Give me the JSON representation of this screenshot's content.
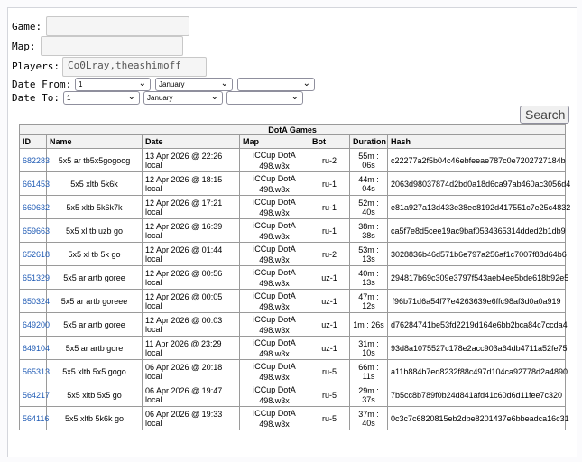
{
  "form": {
    "game_label": "Game:",
    "game_value": "",
    "map_label": "Map:",
    "map_value": "",
    "players_label": "Players:",
    "players_value": "Co0Lray,theashimoff",
    "date_from_label": "Date From:",
    "date_to_label": "Date To:",
    "from_day": "1",
    "from_month": "January",
    "from_year": "",
    "to_day": "1",
    "to_month": "January",
    "to_year": "",
    "search_label": "Search"
  },
  "table": {
    "caption": "DotA Games",
    "headers": [
      "ID",
      "Name",
      "Date",
      "Map",
      "Bot",
      "Duration",
      "Hash"
    ],
    "rows": [
      {
        "id": "682283",
        "name": "5x5 ar tb5x5gogoog",
        "date": "13 Apr 2026 @ 22:26 local",
        "map1": "iCCup DotA",
        "map2": "498.w3x",
        "bot": "ru-2",
        "duration": "55m : 06s",
        "hash": "c22277a2f5b04c46ebfeeae787c0e7202727184b"
      },
      {
        "id": "661453",
        "name": "5x5 xltb 5k6k",
        "date": "12 Apr 2026 @ 18:15 local",
        "map1": "iCCup DotA",
        "map2": "498.w3x",
        "bot": "ru-1",
        "duration": "44m : 04s",
        "hash": "2063d98037874d2bd0a18d6ca97ab460ac3056d4"
      },
      {
        "id": "660632",
        "name": "5x5 xltb 5k6k7k",
        "date": "12 Apr 2026 @ 17:21 local",
        "map1": "iCCup DotA",
        "map2": "498.w3x",
        "bot": "ru-1",
        "duration": "52m : 40s",
        "hash": "e81a927a13d433e38ee8192d417551c7e25c4832"
      },
      {
        "id": "659663",
        "name": "5x5 xl tb uzb go",
        "date": "12 Apr 2026 @ 16:39 local",
        "map1": "iCCup DotA",
        "map2": "498.w3x",
        "bot": "ru-1",
        "duration": "38m : 38s",
        "hash": "ca5f7e8d5cee19ac9baf0534365314dded2b1db9"
      },
      {
        "id": "652618",
        "name": "5x5 xl tb 5k go",
        "date": "12 Apr 2026 @ 01:44 local",
        "map1": "iCCup DotA",
        "map2": "498.w3x",
        "bot": "ru-2",
        "duration": "53m : 13s",
        "hash": "3028836b46d571b6e797a256af1c7007f88d64b6"
      },
      {
        "id": "651329",
        "name": "5x5 ar artb goree",
        "date": "12 Apr 2026 @ 00:56 local",
        "map1": "iCCup DotA",
        "map2": "498.w3x",
        "bot": "uz-1",
        "duration": "40m : 13s",
        "hash": "294817b69c309e3797f543aeb4ee5bde618b92e5"
      },
      {
        "id": "650324",
        "name": "5x5 ar artb goreee",
        "date": "12 Apr 2026 @ 00:05 local",
        "map1": "iCCup DotA",
        "map2": "498.w3x",
        "bot": "uz-1",
        "duration": "47m : 12s",
        "hash": "f96b71d6a54f77e4263639e6ffc98af3d0a0a919"
      },
      {
        "id": "649200",
        "name": "5x5 ar artb goree",
        "date": "12 Apr 2026 @ 00:03 local",
        "map1": "iCCup DotA",
        "map2": "498.w3x",
        "bot": "uz-1",
        "duration": "1m : 26s",
        "hash": "d76284741be53fd2219d164e6bb2bca84c7ccda4"
      },
      {
        "id": "649104",
        "name": "5x5 ar artb gore",
        "date": "11 Apr 2026 @ 23:29 local",
        "map1": "iCCup DotA",
        "map2": "498.w3x",
        "bot": "uz-1",
        "duration": "31m : 10s",
        "hash": "93d8a1075527c178e2acc903a64db4711a52fe75"
      },
      {
        "id": "565313",
        "name": "5x5 xltb 5x5 gogo",
        "date": "06 Apr 2026 @ 20:18 local",
        "map1": "iCCup DotA",
        "map2": "498.w3x",
        "bot": "ru-5",
        "duration": "66m : 11s",
        "hash": "a11b884b7ed8232f88c497d104ca92778d2a4890"
      },
      {
        "id": "564217",
        "name": "5x5 xltb 5x5 go",
        "date": "06 Apr 2026 @ 19:47 local",
        "map1": "iCCup DotA",
        "map2": "498.w3x",
        "bot": "ru-5",
        "duration": "29m : 37s",
        "hash": "7b5cc8b789f0b24d841afd41c60d6d11fee7c320"
      },
      {
        "id": "564116",
        "name": "5x5 xltb 5k6k go",
        "date": "06 Apr 2026 @ 19:33 local",
        "map1": "iCCup DotA",
        "map2": "498.w3x",
        "bot": "ru-5",
        "duration": "37m : 40s",
        "hash": "0c3c7c6820815eb2dbe8201437e6bbeadca16c31"
      }
    ]
  },
  "icons": {
    "dropdown": "chevron-down-icon"
  },
  "colors": {
    "link": "#1f5bb5",
    "header_bg": "#f2f2f2"
  }
}
